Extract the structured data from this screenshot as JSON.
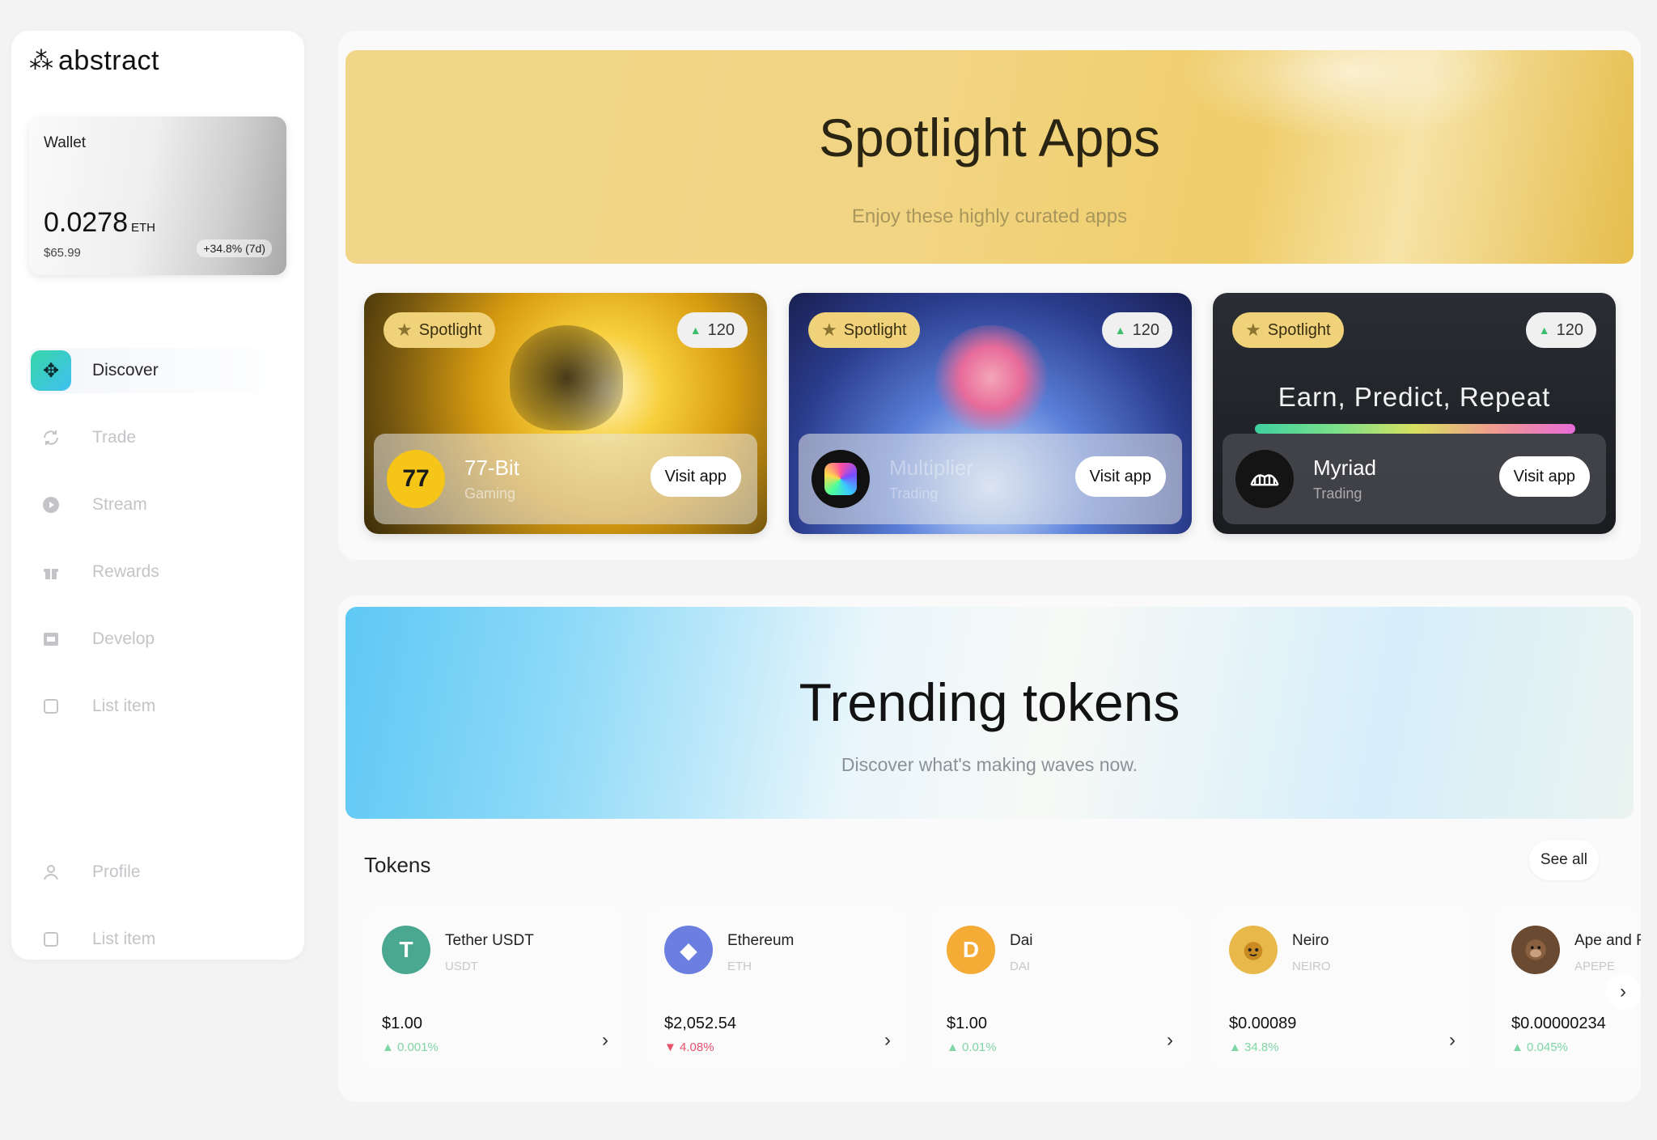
{
  "brand": {
    "logo_text": "abstract"
  },
  "wallet": {
    "label": "Wallet",
    "amount": "0.0278",
    "unit": "ETH",
    "usd": "$65.99",
    "change": "+34.8% (7d)"
  },
  "nav": {
    "discover": "Discover",
    "trade": "Trade",
    "stream": "Stream",
    "rewards": "Rewards",
    "develop": "Develop",
    "list_item_1": "List item",
    "profile": "Profile",
    "list_item_2": "List item"
  },
  "spotlight": {
    "title": "Spotlight Apps",
    "subtitle": "Enjoy these highly curated apps",
    "cards": [
      {
        "badge": "Spotlight",
        "count": "120",
        "name": "77-Bit",
        "category": "Gaming",
        "button": "Visit app",
        "icon_text": "77"
      },
      {
        "badge": "Spotlight",
        "count": "120",
        "name": "Multiplier",
        "category": "Trading",
        "button": "Visit app"
      },
      {
        "badge": "Spotlight",
        "count": "120",
        "name": "Myriad",
        "category": "Trading",
        "button": "Visit app",
        "headline": "Earn, Predict, Repeat"
      }
    ]
  },
  "trending": {
    "title": "Trending tokens",
    "subtitle": "Discover what's making waves now.",
    "tokens_title": "Tokens",
    "see_all": "See all",
    "tokens": [
      {
        "name": "Tether USDT",
        "symbol": "USDT",
        "price": "$1.00",
        "change": "▲ 0.001%",
        "color": "#4aa890",
        "icon_text": "T"
      },
      {
        "name": "Ethereum",
        "symbol": "ETH",
        "price": "$2,052.54",
        "change": "▼ 4.08%",
        "color": "#6a7fe0",
        "icon_text": "◆"
      },
      {
        "name": "Dai",
        "symbol": "DAI",
        "price": "$1.00",
        "change": "▲ 0.01%",
        "color": "#f5ac37",
        "icon_text": "D"
      },
      {
        "name": "Neiro",
        "symbol": "NEIRO",
        "price": "$0.00089",
        "change": "▲ 34.8%",
        "color": "#e9b84a",
        "icon_text": ""
      },
      {
        "name": "Ape and F",
        "symbol": "APEPE",
        "price": "$0.00000234",
        "change": "▲ 0.045%",
        "color": "#6a4a30",
        "icon_text": ""
      }
    ]
  },
  "colors": {
    "accent_green": "#3bbf6e",
    "down_red": "#e8506a",
    "spotlight_gold": "#f0d27a"
  }
}
